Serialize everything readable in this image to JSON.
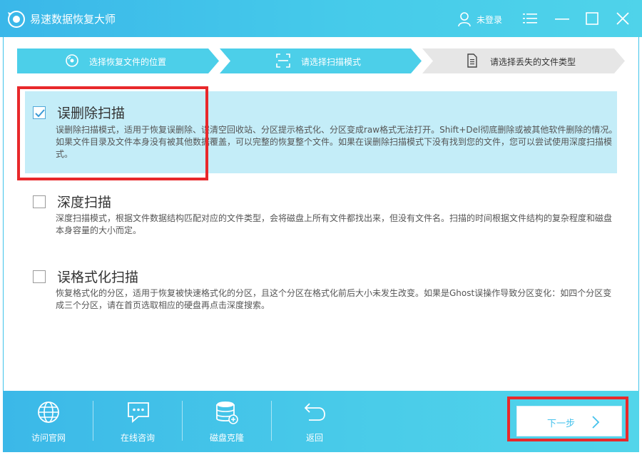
{
  "app": {
    "title": "易速数据恢复大师",
    "user_label": "未登录"
  },
  "colors": {
    "accent": "#3fc3ea",
    "selected_bg": "#c4edf8",
    "highlight_red": "#e8282b",
    "step_inactive": "#e6e6e6"
  },
  "steps": [
    {
      "label": "选择恢复文件的位置",
      "icon": "disc-icon",
      "state": "done"
    },
    {
      "label": "请选择扫描模式",
      "icon": "scan-icon",
      "state": "done"
    },
    {
      "label": "请选择丢失的文件类型",
      "icon": "document-icon",
      "state": "current"
    }
  ],
  "options": [
    {
      "title": "误删除扫描",
      "checked": true,
      "desc": "误删除扫描模式，适用于恢复误删除、误清空回收站、分区提示格式化、分区变成raw格式无法打开。Shift+Del彻底删除或被其他软件删除的情况。如果文件目录及文件本身没有被其他数据覆盖，可以完整的恢复整个文件。如果在误删除扫描模式下没有找到您的文件，您可以尝试使用深度扫描模式。"
    },
    {
      "title": "深度扫描",
      "checked": false,
      "desc": "深度扫描模式，根据文件数据结构匹配对应的文件类型，会将磁盘上所有文件都找出来，但没有文件名。扫描的时间根据文件结构的复杂程度和磁盘本身容量的大小而定。"
    },
    {
      "title": "误格式化扫描",
      "checked": false,
      "desc": "恢复格式化的分区，适用于恢复被快速格式化的分区，且这个分区在格式化前后大小未发生改变。如果是Ghost误操作导致分区变化：如四个分区变成三个分区，请在首页选取相应的硬盘再点击深度搜索。"
    }
  ],
  "footer": {
    "items": [
      {
        "label": "访问官网",
        "icon": "globe-icon"
      },
      {
        "label": "在线咨询",
        "icon": "chat-icon"
      },
      {
        "label": "磁盘克隆",
        "icon": "disk-clone-icon"
      },
      {
        "label": "返回",
        "icon": "back-arrow-icon"
      }
    ],
    "next_label": "下一步"
  }
}
